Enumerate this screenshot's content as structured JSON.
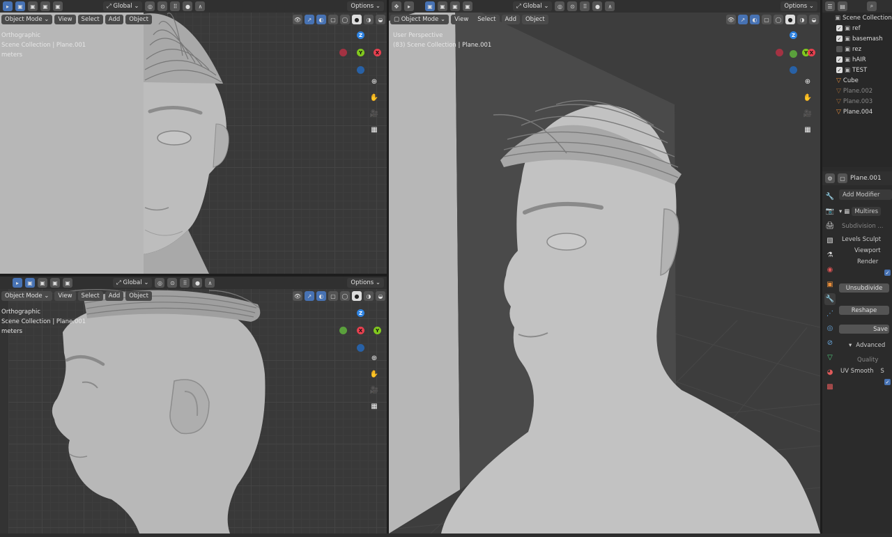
{
  "toolbar": {
    "transform_orientation": "Global",
    "options_label": "Options",
    "mode": "Object Mode",
    "menu_view": "View",
    "menu_select": "Select",
    "menu_add": "Add",
    "menu_object": "Object"
  },
  "viewports": {
    "front": {
      "info_lines": [
        "Orthographic",
        "Scene Collection | Plane.001",
        "meters"
      ]
    },
    "side": {
      "info_lines": [
        "Orthographic",
        "Scene Collection | Plane.001",
        "meters"
      ]
    },
    "persp": {
      "info_lines": [
        "User Perspective",
        "(83) Scene Collection | Plane.001"
      ]
    }
  },
  "gizmo": {
    "x": "X",
    "y": "Y",
    "z": "Z"
  },
  "outliner": {
    "header": "Scene Collection",
    "items": [
      {
        "label": "ref",
        "kind": "collection",
        "checked": true
      },
      {
        "label": "basemash",
        "kind": "collection",
        "checked": true
      },
      {
        "label": "rez",
        "kind": "collection",
        "checked": false
      },
      {
        "label": "hAIR",
        "kind": "collection",
        "checked": true
      },
      {
        "label": "TEST",
        "kind": "collection",
        "checked": true
      },
      {
        "label": "Cube",
        "kind": "mesh"
      },
      {
        "label": "Plane.002",
        "kind": "mesh-dim"
      },
      {
        "label": "Plane.003",
        "kind": "mesh-dim"
      },
      {
        "label": "Plane.004",
        "kind": "mesh"
      }
    ]
  },
  "properties": {
    "object_name": "Plane.001",
    "add_modifier": "Add Modifier",
    "modifier_name": "Multires",
    "subdivision_label": "Subdivision ...",
    "levels_sculpt": "Levels Sculpt",
    "viewport": "Viewport",
    "render": "Render",
    "unsubdivide": "Unsubdivide",
    "reshape": "Reshape",
    "save": "Save",
    "advanced": "Advanced",
    "quality": "Quality",
    "uv_smooth": "UV Smooth",
    "uv_smooth_value": "S"
  },
  "colors": {
    "accent": "#4772b3",
    "axis_x": "#e8404f",
    "axis_y": "#82c91e",
    "axis_z": "#2f84e3"
  }
}
